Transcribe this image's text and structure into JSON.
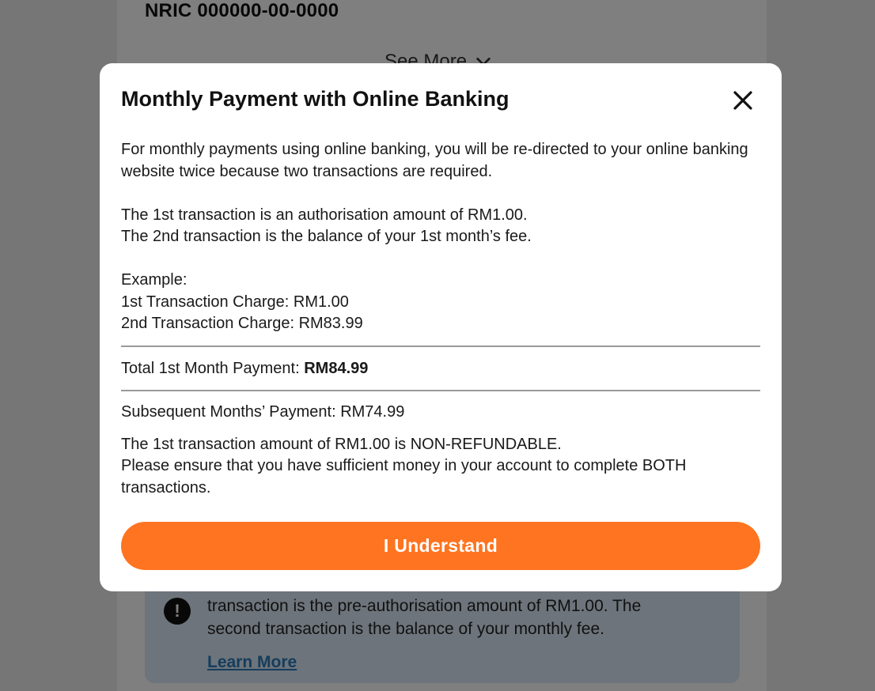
{
  "background": {
    "nric_text": "NRIC 000000-00-0000",
    "see_more_label": "See More",
    "info_text": "transaction is the pre-authorisation amount of RM1.00. The second transaction is the balance of your monthly fee.",
    "learn_more_label": "Learn More"
  },
  "modal": {
    "title": "Monthly Payment with Online Banking",
    "intro": "For monthly payments using online banking, you will be re-directed to your online banking website twice because two transactions are required.",
    "first_txn": "The 1st transaction is an authorisation amount of RM1.00.",
    "second_txn": "The 2nd transaction is the balance of your 1st month’s fee.",
    "example_label": "Example:",
    "example_first": "1st Transaction Charge: RM1.00",
    "example_second": "2nd Transaction Charge: RM83.99",
    "total_label": "Total 1st Month Payment: ",
    "total_value": "RM84.99",
    "subsequent": "Subsequent Months’ Payment: RM74.99",
    "non_refundable": "The 1st transaction amount of RM1.00 is NON-REFUNDABLE.",
    "ensure": "Please ensure that you have sufficient money in your account to complete BOTH transactions.",
    "cta_label": "I Understand"
  },
  "colors": {
    "accent": "#ff7420",
    "info_bg": "#dbe9f6",
    "link": "#2a7ab8"
  },
  "icons": [
    "chevron-down-icon",
    "close-icon",
    "exclamation-icon"
  ]
}
